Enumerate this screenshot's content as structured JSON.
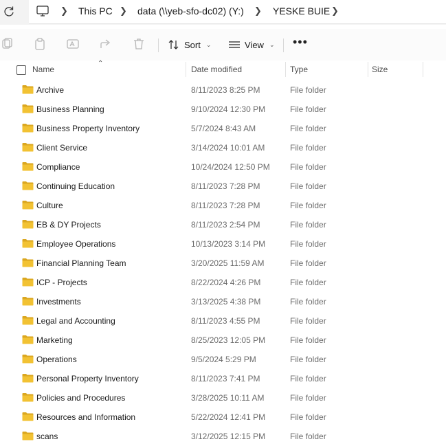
{
  "address_bar": {
    "crumbs": [
      "This PC",
      "data (\\\\yeb-sfo-dc02) (Y:)",
      "YESKE BUIE"
    ]
  },
  "toolbar": {
    "sort_label": "Sort",
    "view_label": "View",
    "more_label": "•••"
  },
  "columns": {
    "name": "Name",
    "date_modified": "Date modified",
    "type": "Type",
    "size": "Size"
  },
  "files": [
    {
      "name": "Archive",
      "date": "8/11/2023 8:25 PM",
      "type": "File folder",
      "size": ""
    },
    {
      "name": "Business Planning",
      "date": "9/10/2024 12:30 PM",
      "type": "File folder",
      "size": ""
    },
    {
      "name": "Business Property Inventory",
      "date": "5/7/2024 8:43 AM",
      "type": "File folder",
      "size": ""
    },
    {
      "name": "Client Service",
      "date": "3/14/2024 10:01 AM",
      "type": "File folder",
      "size": ""
    },
    {
      "name": "Compliance",
      "date": "10/24/2024 12:50 PM",
      "type": "File folder",
      "size": ""
    },
    {
      "name": "Continuing Education",
      "date": "8/11/2023 7:28 PM",
      "type": "File folder",
      "size": ""
    },
    {
      "name": "Culture",
      "date": "8/11/2023 7:28 PM",
      "type": "File folder",
      "size": ""
    },
    {
      "name": "EB & DY Projects",
      "date": "8/11/2023 2:54 PM",
      "type": "File folder",
      "size": ""
    },
    {
      "name": "Employee Operations",
      "date": "10/13/2023 3:14 PM",
      "type": "File folder",
      "size": ""
    },
    {
      "name": "Financial Planning Team",
      "date": "3/20/2025 11:59 AM",
      "type": "File folder",
      "size": ""
    },
    {
      "name": "ICP - Projects",
      "date": "8/22/2024 4:26 PM",
      "type": "File folder",
      "size": ""
    },
    {
      "name": "Investments",
      "date": "3/13/2025 4:38 PM",
      "type": "File folder",
      "size": ""
    },
    {
      "name": "Legal and Accounting",
      "date": "8/11/2023 4:55 PM",
      "type": "File folder",
      "size": ""
    },
    {
      "name": "Marketing",
      "date": "8/25/2023 12:05 PM",
      "type": "File folder",
      "size": ""
    },
    {
      "name": "Operations",
      "date": "9/5/2024 5:29 PM",
      "type": "File folder",
      "size": ""
    },
    {
      "name": "Personal Property Inventory",
      "date": "8/11/2023 7:41 PM",
      "type": "File folder",
      "size": ""
    },
    {
      "name": "Policies and Procedures",
      "date": "3/28/2025 10:11 AM",
      "type": "File folder",
      "size": ""
    },
    {
      "name": "Resources and Information",
      "date": "5/22/2024 12:41 PM",
      "type": "File folder",
      "size": ""
    },
    {
      "name": "scans",
      "date": "3/12/2025 12:15 PM",
      "type": "File folder",
      "size": ""
    }
  ],
  "colors": {
    "folder": "#f2c233",
    "folder_dark": "#dba720",
    "accent": "#0067c0"
  }
}
